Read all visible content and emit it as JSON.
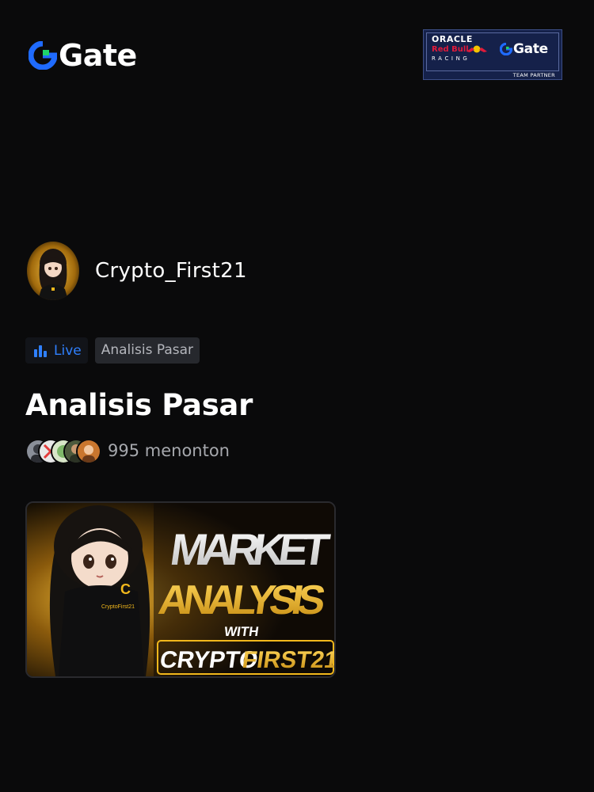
{
  "header": {
    "brand": "Gate",
    "partner_badge": {
      "line1": "ORACLE",
      "line2": "Red Bull",
      "line3": "RACING",
      "brand": "Gate",
      "caption": "TEAM PARTNER"
    }
  },
  "streamer": {
    "name": "Crypto_First21"
  },
  "tags": {
    "live_label": "Live",
    "topic_label": "Analisis Pasar"
  },
  "stream": {
    "title": "Analisis Pasar",
    "viewers": "995 menonton"
  },
  "thumbnail": {
    "line1": "MARKET",
    "line2": "ANALYSIS",
    "line3": "WITH",
    "line4_a": "CRYPTO",
    "line4_b": "FIRST21",
    "hoodie_text": "CryptoFirst21"
  },
  "colors": {
    "background": "#0a0a0b",
    "accent_blue": "#2f80ff",
    "logo_green": "#1fd36a",
    "gold": "#f2b81c"
  }
}
